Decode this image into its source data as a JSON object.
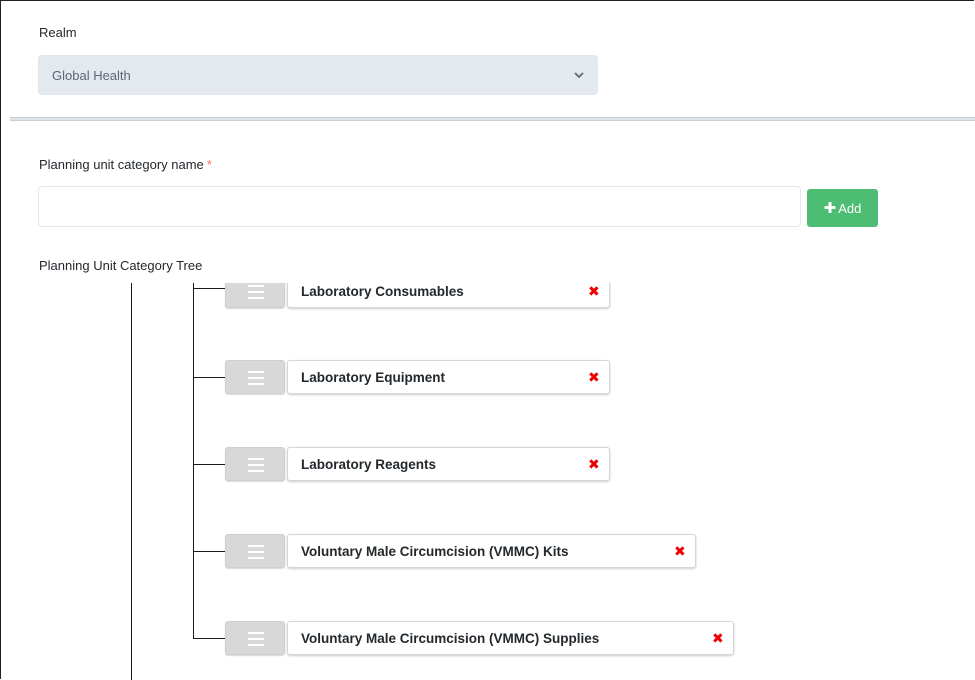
{
  "form": {
    "realm_label": "Realm",
    "realm_value": "Global Health",
    "category_name_label": "Planning unit category name",
    "required_mark": "*",
    "category_name_value": "",
    "add_button_label": "Add",
    "add_icon": "plus-icon",
    "tree_label": "Planning Unit Category Tree"
  },
  "tree": {
    "nodes": [
      {
        "label": "Laboratory Consumables",
        "delete_icon": "✖"
      },
      {
        "label": "Laboratory Equipment",
        "delete_icon": "✖"
      },
      {
        "label": "Laboratory Reagents",
        "delete_icon": "✖"
      },
      {
        "label": "Voluntary Male Circumcision (VMMC) Kits",
        "delete_icon": "✖"
      },
      {
        "label": "Voluntary Male Circumcision (VMMC) Supplies",
        "delete_icon": "✖"
      }
    ]
  },
  "colors": {
    "add_button": "#4dbd74",
    "delete_icon": "#ee0000",
    "select_bg": "#e4e9ef"
  }
}
